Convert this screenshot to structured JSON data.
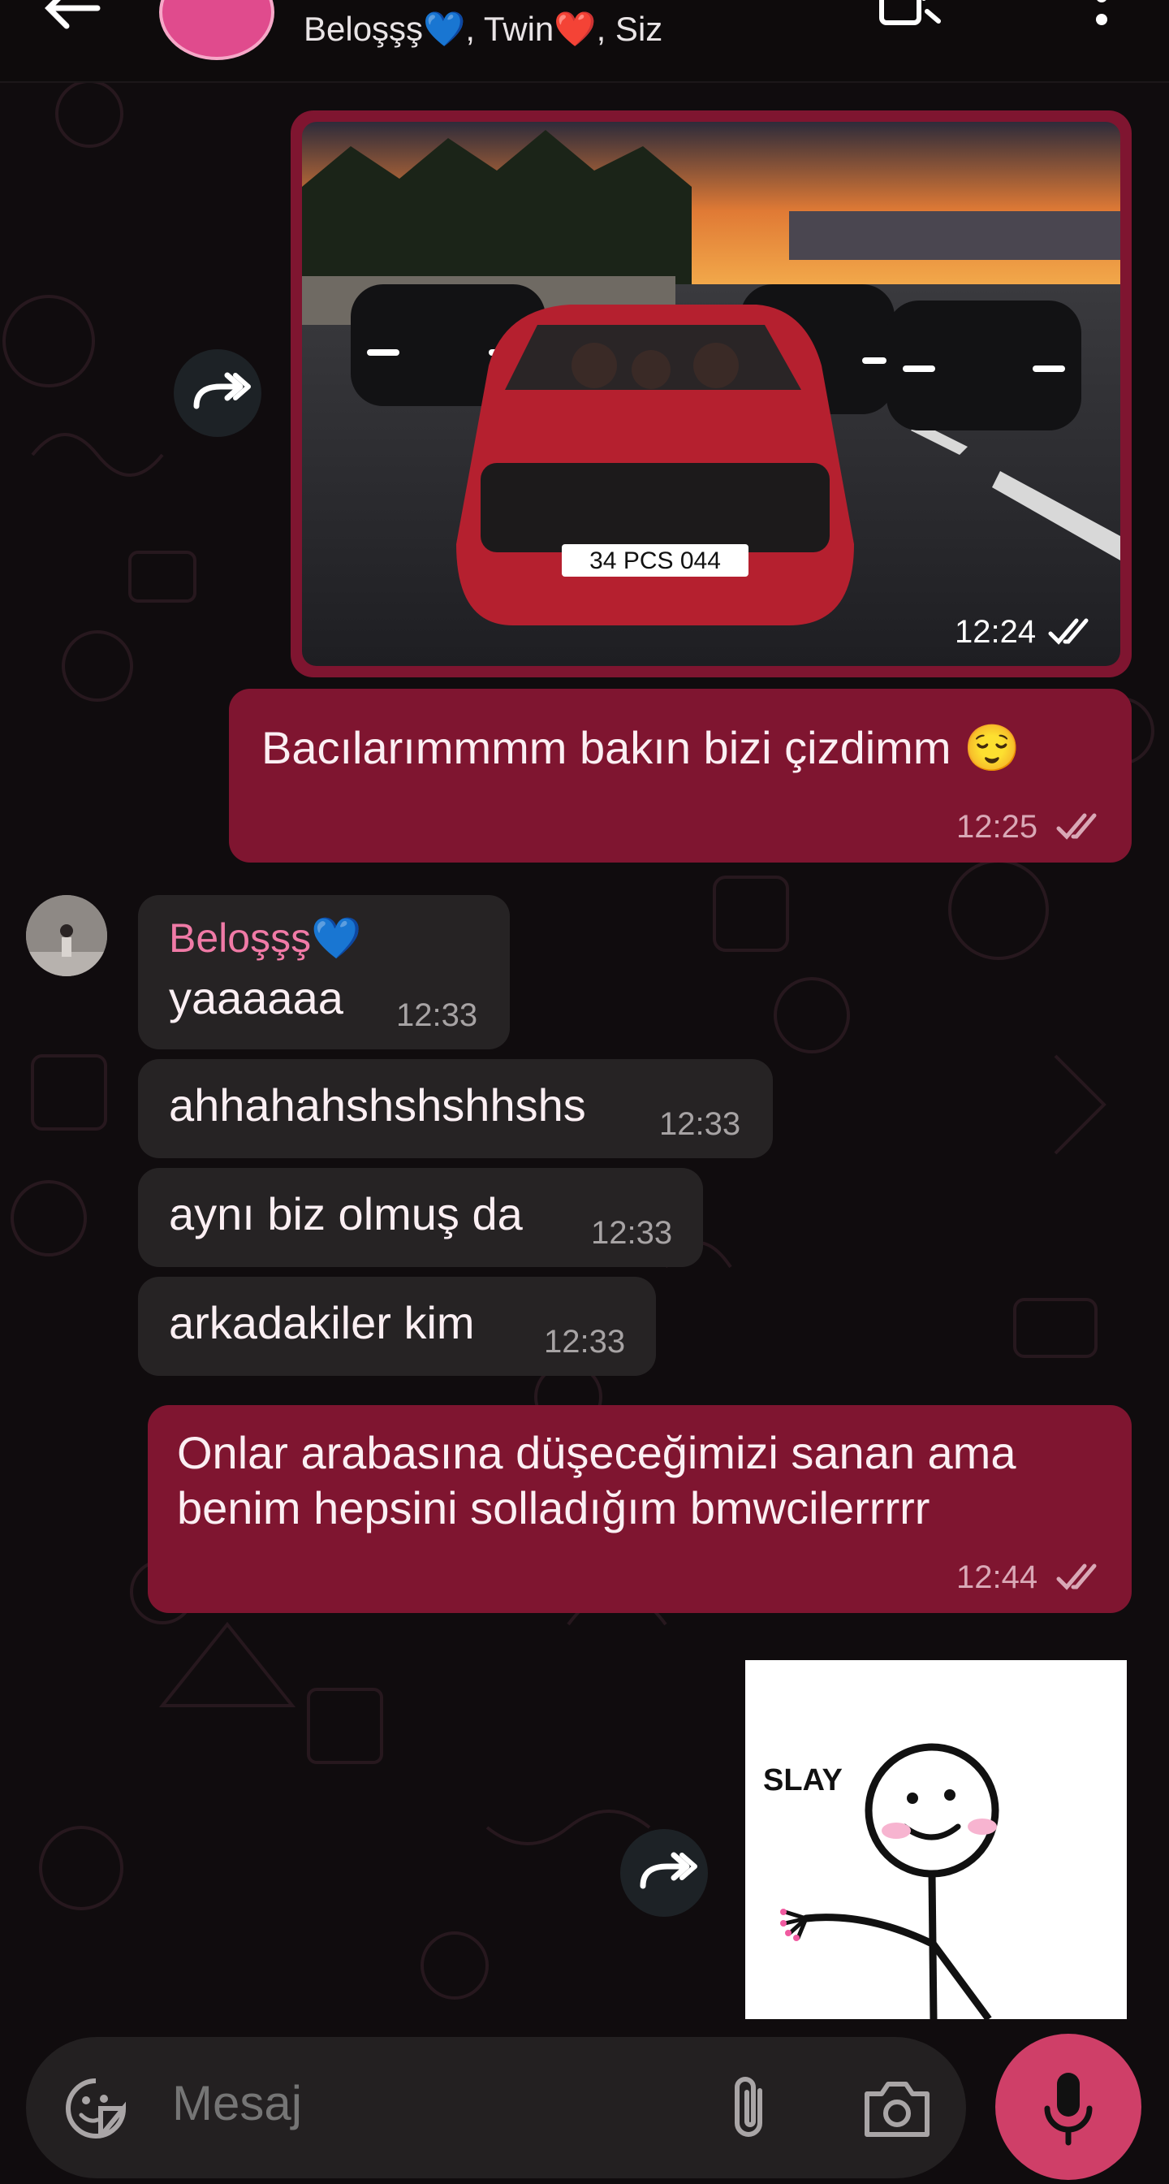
{
  "header": {
    "members": "Beloşşş💙, Twin❤️, Siz"
  },
  "messages": {
    "photo": {
      "time": "12:24"
    },
    "out1": {
      "text": "Bacılarımmmm bakın bizi çizdimm 😌",
      "time": "12:25"
    },
    "sender": {
      "name": "Beloşşş💙"
    },
    "in1": {
      "text": "yaaaaaa",
      "time": "12:33"
    },
    "in2": {
      "text": "ahhahahshshshhshs",
      "time": "12:33"
    },
    "in3": {
      "text": "aynı biz olmuş da",
      "time": "12:33"
    },
    "in4": {
      "text": "arkadakiler kim",
      "time": "12:33"
    },
    "out2": {
      "line1": "Onlar arabasına düşeceğimizi sanan ama",
      "line2": "benim hepsini solladığım bmwcilerrrrr",
      "time": "12:44"
    },
    "sticker": {
      "text": "SLAY"
    },
    "photo_plate": "34 PCS 044"
  },
  "composer": {
    "placeholder": "Mesaj"
  },
  "colors": {
    "outgoing_bubble": "#7f1530",
    "incoming_bubble": "#262324",
    "accent": "#cf3f68",
    "sender_name": "#f07aa6"
  }
}
